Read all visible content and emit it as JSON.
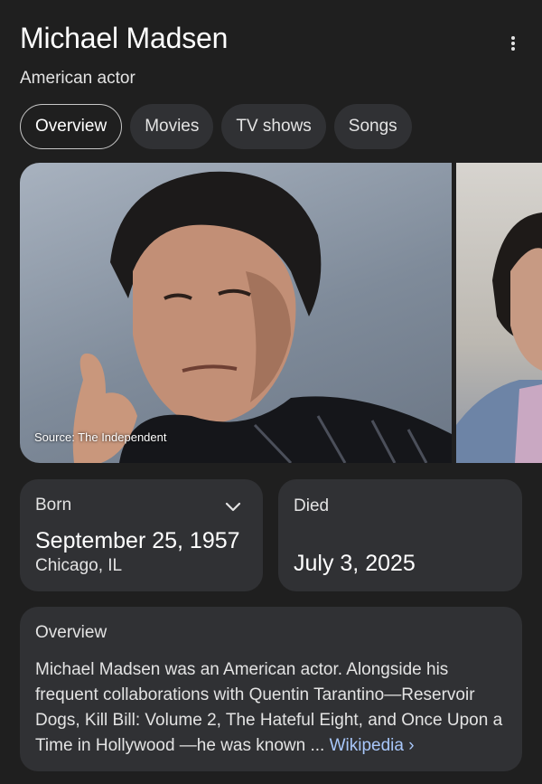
{
  "entity": {
    "name": "Michael Madsen",
    "description": "American actor"
  },
  "menu_icon": "more-vert-icon",
  "tabs": [
    {
      "label": "Overview",
      "active": true
    },
    {
      "label": "Movies",
      "active": false
    },
    {
      "label": "TV shows",
      "active": false
    },
    {
      "label": "Songs",
      "active": false
    }
  ],
  "image": {
    "source_label": "Source: The Independent"
  },
  "born": {
    "label": "Born",
    "date": "September 25, 1957",
    "place": "Chicago, IL",
    "icon": "chevron-down-icon"
  },
  "died": {
    "label": "Died",
    "date": "July 3, 2025"
  },
  "overview": {
    "title": "Overview",
    "text": "Michael Madsen was an American actor. Alongside his frequent collaborations with Quentin Tarantino—Reservoir Dogs, Kill Bill: Volume 2, The Hateful Eight, and Once Upon a Time in Hollywood —he was known ... ",
    "link_label": "Wikipedia ›"
  },
  "colors": {
    "background": "#1f1f1f",
    "card": "#303134",
    "link": "#a8c7fa"
  }
}
